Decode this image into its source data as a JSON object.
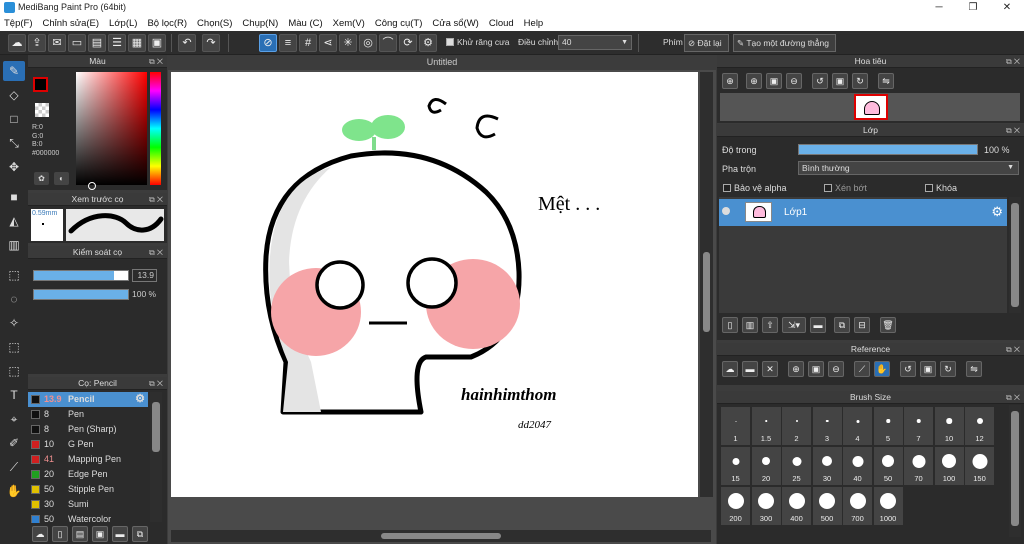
{
  "window": {
    "title": "MediBang Paint Pro (64bit)",
    "minimize": "─",
    "maximize": "❐",
    "close": "✕"
  },
  "menu": [
    "Tệp(F)",
    "Chỉnh sửa(E)",
    "Lớp(L)",
    "Bộ lọc(R)",
    "Chọn(S)",
    "Chụp(N)",
    "Màu (C)",
    "Xem(V)",
    "Công cụ(T)",
    "Cửa sổ(W)",
    "Cloud",
    "Help"
  ],
  "toolbar": {
    "antialias_label": "Khử răng cưa",
    "adjust_label": "Điều chỉnh",
    "adjust_value": "40",
    "ruler_label": "Phím",
    "reset_label": "Đặt lại",
    "straight_line_label": "Tạo một đường thẳng"
  },
  "color_panel": {
    "title": "Màu",
    "r": "R:0",
    "g": "G:0",
    "b": "B:0",
    "hex": "#000000",
    "primary_color": "#000000",
    "secondary_color": "#ffffff"
  },
  "brush_preview": {
    "title": "Xem trước cọ",
    "size": "0.59mm"
  },
  "brush_control": {
    "title": "Kiểm soát cọ",
    "size_value": "13.9",
    "size_fraction": 0.85,
    "opacity_value": "100 %",
    "opacity_fraction": 1.0
  },
  "brush_list": {
    "title": "Cọ: Pencil",
    "items": [
      {
        "size": "13.9",
        "name": "Pencil",
        "color": "#111111",
        "selected": true
      },
      {
        "size": "8",
        "name": "Pen",
        "color": "#111111"
      },
      {
        "size": "8",
        "name": "Pen (Sharp)",
        "color": "#111111"
      },
      {
        "size": "10",
        "name": "G Pen",
        "color": "#d02020"
      },
      {
        "size": "41",
        "name": "Mapping Pen",
        "color": "#d02020"
      },
      {
        "size": "20",
        "name": "Edge Pen",
        "color": "#20a020"
      },
      {
        "size": "50",
        "name": "Stipple Pen",
        "color": "#e0c000"
      },
      {
        "size": "30",
        "name": "Sumi",
        "color": "#e0c000"
      },
      {
        "size": "50",
        "name": "Watercolor",
        "color": "#3080d0"
      }
    ]
  },
  "canvas": {
    "tab_title": "Untitled",
    "text_tired": "Mệt . . .",
    "signature": "hainhimthom",
    "signature_sub": "dd2047"
  },
  "navigator": {
    "title": "Hoa tiêu"
  },
  "layer_panel": {
    "title": "Lớp",
    "opacity_label": "Độ trong",
    "opacity_value": "100 %",
    "opacity_fraction": 1.0,
    "blend_label": "Pha trộn",
    "blend_value": "Bình thường",
    "protect_alpha_label": "Bảo vệ alpha",
    "clipping_label": "Xén bớt",
    "lock_label": "Khóa",
    "layers": [
      {
        "name": "Lớp1"
      }
    ]
  },
  "reference": {
    "title": "Reference"
  },
  "brush_size": {
    "title": "Brush Size",
    "sizes": [
      "1",
      "1.5",
      "2",
      "3",
      "4",
      "5",
      "7",
      "10",
      "12",
      "15",
      "20",
      "25",
      "30",
      "40",
      "50",
      "70",
      "100",
      "150",
      "200",
      "300",
      "400",
      "500",
      "700",
      "1000"
    ]
  }
}
